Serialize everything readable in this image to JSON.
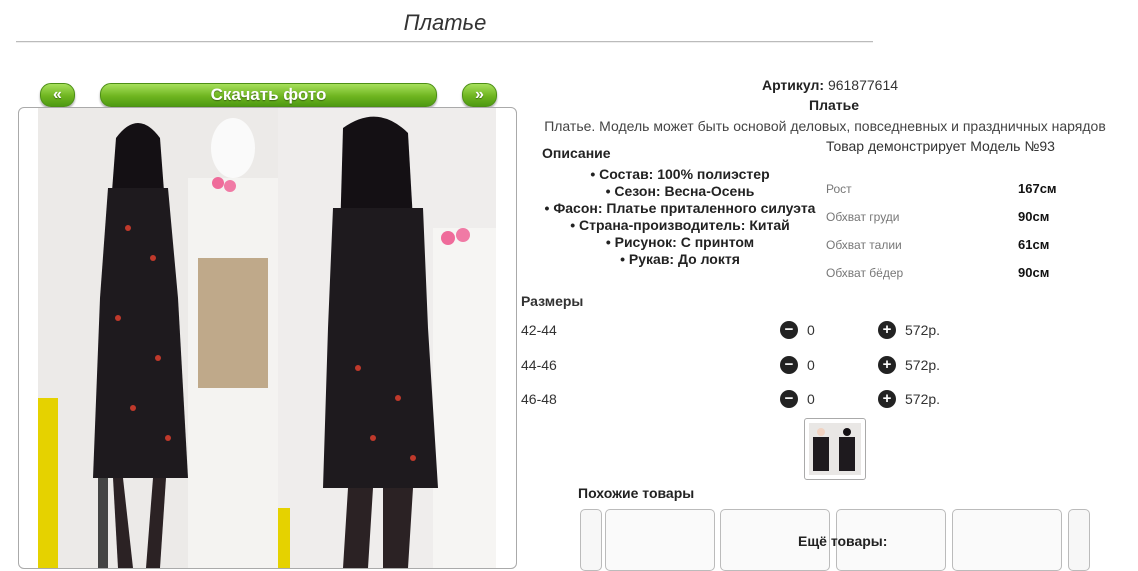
{
  "page": {
    "title": "Платье"
  },
  "gallery": {
    "prev_label": "«",
    "download_label": "Скачать фото",
    "next_label": "»"
  },
  "product": {
    "article_label": "Артикул:",
    "article_value": "961877614",
    "name": "Платье",
    "description": "Платье. Модель может быть основой деловых, повседневных и праздничных нарядов"
  },
  "specs": {
    "heading": "Описание",
    "items": [
      "Состав: 100% полиэстер",
      "Сезон: Весна-Осень",
      "Фасон: Платье приталенного силуэта",
      "Страна-производитель: Китай",
      "Рисунок: С принтом",
      "Рукав: До локтя"
    ]
  },
  "model": {
    "heading": "Товар демонстрирует Модель №93",
    "rows": [
      {
        "label": "Рост",
        "value": "167см"
      },
      {
        "label": "Обхват груди",
        "value": "90см"
      },
      {
        "label": "Обхват талии",
        "value": "61см"
      },
      {
        "label": "Обхват бёдер",
        "value": "90см"
      }
    ]
  },
  "sizes": {
    "heading": "Размеры",
    "rows": [
      {
        "size": "42-44",
        "qty": "0",
        "price": "572р."
      },
      {
        "size": "44-46",
        "qty": "0",
        "price": "572р."
      },
      {
        "size": "46-48",
        "qty": "0",
        "price": "572р."
      }
    ]
  },
  "similar": {
    "heading": "Похожие товары"
  },
  "more": {
    "heading": "Ещё товары:"
  },
  "colors": {
    "button_green": "#6fb520",
    "dress": "#1e1a1e",
    "print_red": "#c0392b"
  }
}
